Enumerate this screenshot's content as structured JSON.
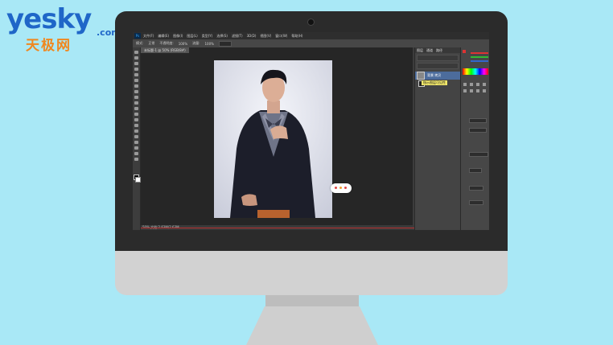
{
  "logo": {
    "word": "yesky",
    "dotcom": ".com",
    "chinese": "天极网"
  },
  "photoshop": {
    "app_icon": "Ps",
    "menu": [
      "文件(F)",
      "编辑(E)",
      "图像(I)",
      "图层(L)",
      "类型(Y)",
      "选择(S)",
      "滤镜(T)",
      "3D(D)",
      "视图(V)",
      "窗口(W)",
      "帮助(H)"
    ],
    "options": [
      "模式:",
      "正常",
      "不透明度:",
      "100%",
      "流量:",
      "100%"
    ],
    "document_tab": "未标题-1 @ 50% (RGB/8#)",
    "status": "50%    文档:2.63M/2.63M",
    "layers_panel": {
      "tabs": [
        "图层",
        "通道",
        "路径"
      ],
      "layer_name": "背景 拷贝",
      "tooltip": "指示图层可见性"
    },
    "icons": {
      "move": "move-icon",
      "marquee": "marquee-icon",
      "lasso": "lasso-icon",
      "brush": "brush-icon",
      "eye": "eye-icon"
    }
  },
  "colors": {
    "background": "#a9e8f6",
    "logo_blue": "#1f66c8",
    "logo_orange": "#f0871e",
    "accent_red": "#b83030"
  }
}
